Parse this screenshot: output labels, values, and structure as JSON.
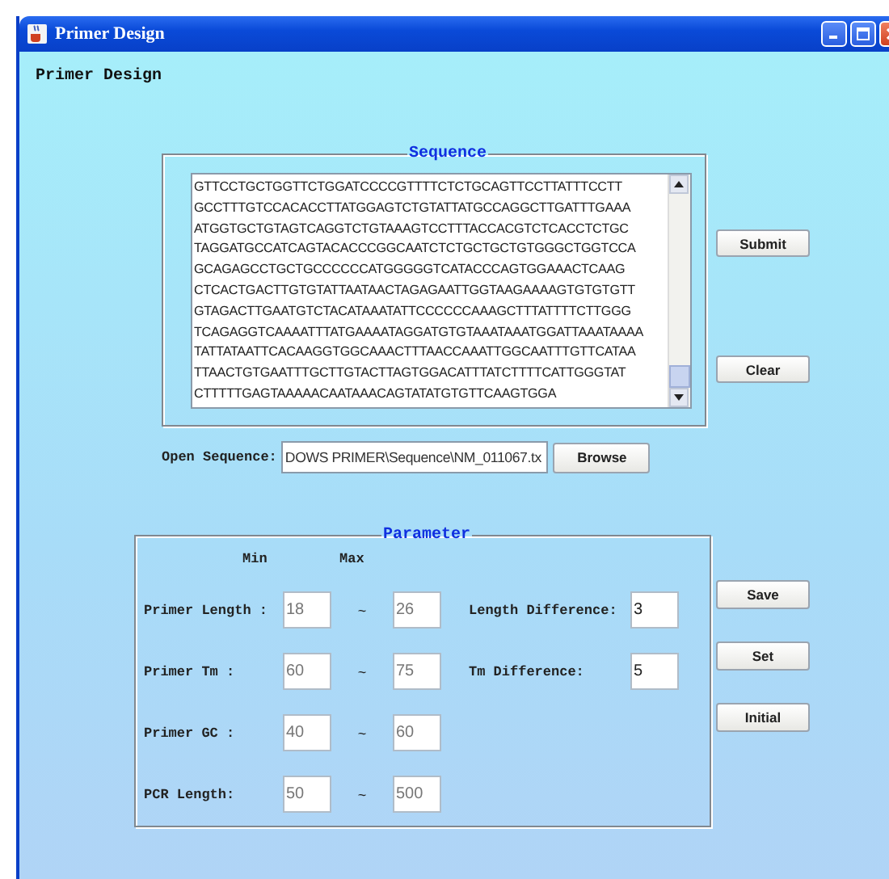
{
  "window": {
    "title": "Primer Design"
  },
  "heading": "Primer Design",
  "sequence": {
    "legend": "Sequence",
    "lines": [
      "GTTCCTGCTGGTTCTGGATCCCCGTTTTCTCTGCAGTTCCTTATTTCCTT",
      "GCCTTTGTCCACACCTTATGGAGTCTGTATTATGCCAGGCTTGATTTGAAA",
      "ATGGTGCTGTAGTCAGGTCTGTAAAGTCCTTTACCACGTCTCACCTCTGC",
      "TAGGATGCCATCAGTACACCCGGCAATCTCTGCTGCTGTGGGCTGGTCCA",
      "GCAGAGCCTGCTGCCCCCCATGGGGGTCATACCCAGTGGAAACTCAAG",
      "CTCACTGACTTGTGTATTAATAACTAGAGAATTGGTAAGAAAAGTGTGTGTT",
      "GTAGACTTGAATGTCTACATAAATATTCCCCCCAAAGCTTTATTTTCTTGGG",
      "TCAGAGGTCAAAATTTATGAAAATAGGATGTGTAAATAAATGGATTAAATAAAA",
      "TATTATAATTCACAAGGTGGCAAACTTTAACCAAATTGGCAATTTGTTCATAA",
      "TTAACTGTGAATTTGCTTGTACTTAGTGGACATTTATCTTTTCATTGGGTAT",
      "CTTTTTGAGTAAAAACAATAAACAGTATATGTGTTCAAGTGGA"
    ]
  },
  "sequence_buttons": [
    "Submit",
    "Clear"
  ],
  "open_sequence": {
    "label": "Open Sequence:",
    "value": "DOWS PRIMER\\Sequence\\NM_011067.tx",
    "button": "Browse"
  },
  "parameter": {
    "legend": "Parameter",
    "min_label": "Min",
    "max_label": "Max",
    "rows": [
      {
        "label": "Primer Length :",
        "min": "18",
        "separator": "~",
        "max": "26",
        "diff_label": "Length Difference:",
        "diff_value": "3"
      },
      {
        "label": "Primer Tm :",
        "min": "60",
        "separator": "~",
        "max": "75",
        "diff_label": "Tm Difference:",
        "diff_value": "5"
      },
      {
        "label": "Primer GC :",
        "min": "40",
        "separator": "~",
        "max": "60"
      },
      {
        "label": "PCR  Length:",
        "min": "50",
        "separator": "~",
        "max": "500"
      }
    ]
  },
  "parameter_buttons": [
    "Save",
    "Set",
    "Initial"
  ]
}
